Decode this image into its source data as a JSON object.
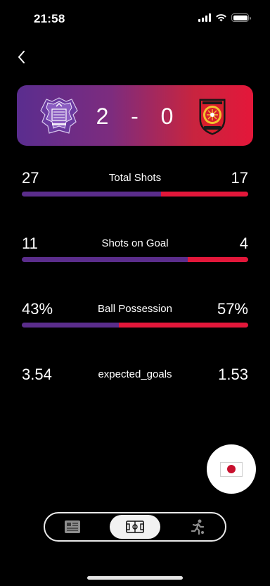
{
  "status_bar": {
    "time": "21:58"
  },
  "match": {
    "home_score": "2",
    "separator": "-",
    "away_score": "0",
    "home_color": "#5b2d8c",
    "away_color": "#e3173a"
  },
  "stats": [
    {
      "label": "Total Shots",
      "home": "27",
      "away": "17",
      "home_share": 0.614
    },
    {
      "label": "Shots on Goal",
      "home": "11",
      "away": "4",
      "home_share": 0.733
    },
    {
      "label": "Ball Possession",
      "home": "43%",
      "away": "57%",
      "home_share": 0.43
    },
    {
      "label": "expected_goals",
      "home": "3.54",
      "away": "1.53"
    }
  ],
  "icons": {
    "back": "chevron-left-icon",
    "home_crest": "home-team-crest",
    "away_crest": "away-team-crest",
    "language": "japan-flag-icon",
    "tabs": [
      "news-icon",
      "pitch-icon",
      "player-running-icon"
    ]
  },
  "tabs": {
    "active_index": 1
  }
}
